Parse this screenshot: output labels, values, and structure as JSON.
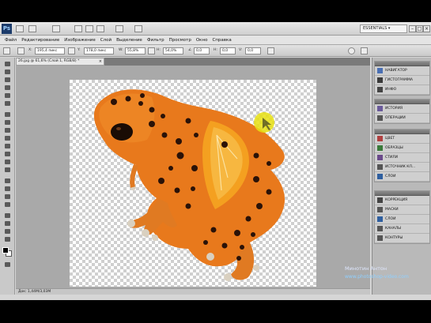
{
  "appbar": {
    "logo": "Ps",
    "workspace": "ESSENTIALS ▾",
    "minimize": "–",
    "maximize": "□",
    "close": "×"
  },
  "menubar": {
    "items": [
      "Файл",
      "Редактирование",
      "Изображение",
      "Слой",
      "Выделение",
      "Фильтр",
      "Просмотр",
      "Окно",
      "Справка"
    ]
  },
  "options": {
    "x_field": "195,4 пикс",
    "y_field": "178,0 пикс",
    "w_field": "55,8%",
    "h_field": "54,0%",
    "angle_field": "0,0",
    "skew_field": "0,0",
    "interp_field": "0,0"
  },
  "document": {
    "tab_title": "26.jpg @ 61,6% (Слой 1, RGB/8) *",
    "close": "×",
    "status": "Док: 1,44M/3,03M"
  },
  "panels": {
    "group1": [
      {
        "label": "НАВИГАТОР",
        "icon": "navigator-icon",
        "color": "#4a6fb3"
      },
      {
        "label": "ГИСТОГРАММА",
        "icon": "histogram-icon",
        "color": "#3a3a3a"
      },
      {
        "label": "ИНФО",
        "icon": "info-icon",
        "color": "#444"
      }
    ],
    "group2": [
      {
        "label": "ИСТОРИЯ",
        "icon": "history-icon",
        "color": "#6a5a9a"
      },
      {
        "label": "ОПЕРАЦИИ",
        "icon": "actions-icon",
        "color": "#555"
      }
    ],
    "group3": [
      {
        "label": "ЦВЕТ",
        "icon": "color-icon",
        "color": "#b04040"
      },
      {
        "label": "ОБРАЗЦЫ",
        "icon": "swatches-icon",
        "color": "#3a7a3a"
      },
      {
        "label": "СТИЛИ",
        "icon": "styles-icon",
        "color": "#6a4a8a"
      },
      {
        "label": "ИСТОЧНИК КЛ...",
        "icon": "clone-source-icon",
        "color": "#555"
      },
      {
        "label": "СЛОИ",
        "icon": "layers-icon",
        "color": "#2f5f9f"
      }
    ],
    "group4": [
      {
        "label": "КОРРЕКЦИЯ",
        "icon": "adjustments-icon",
        "color": "#444"
      },
      {
        "label": "МАСКИ",
        "icon": "masks-icon",
        "color": "#555"
      },
      {
        "label": "СЛОИ",
        "icon": "layers-icon-2",
        "color": "#2f5f9f"
      },
      {
        "label": "КАНАЛЫ",
        "icon": "channels-icon",
        "color": "#555"
      },
      {
        "label": "КОНТУРЫ",
        "icon": "paths-icon",
        "color": "#555"
      }
    ]
  },
  "watermark": {
    "author": "Минотин Антон",
    "site": "www.photoshop-video.com"
  },
  "colors": {
    "frog": "#e87a1c",
    "orange": "#f39a1a",
    "highlight": "#e8e011"
  }
}
